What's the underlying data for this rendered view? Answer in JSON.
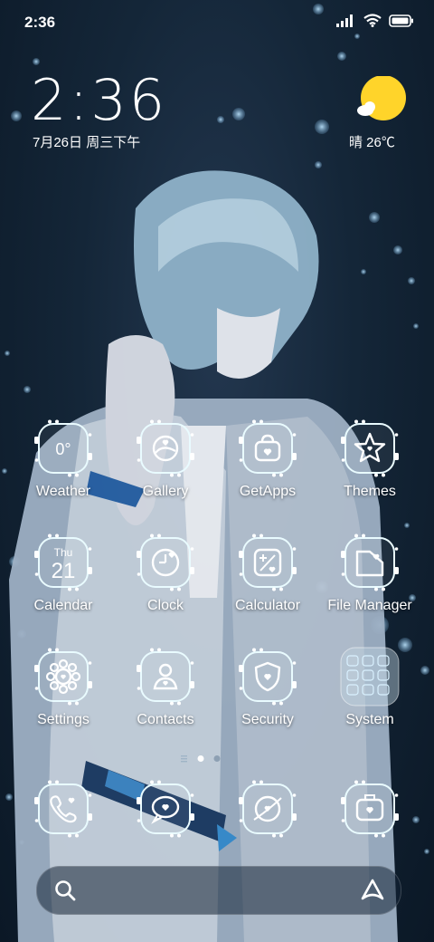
{
  "status": {
    "time": "2:36"
  },
  "lock_clock": {
    "time": "2:36",
    "date": "7月26日 周三下午"
  },
  "weather": {
    "text": "晴 26℃",
    "icon": "sun-cloud-icon",
    "sun_color": "#FFD42A"
  },
  "apps": [
    {
      "label": "Weather",
      "icon": "weather-icon",
      "value": "0°"
    },
    {
      "label": "Gallery",
      "icon": "gallery-icon"
    },
    {
      "label": "GetApps",
      "icon": "getapps-icon"
    },
    {
      "label": "Themes",
      "icon": "themes-icon"
    },
    {
      "label": "Calendar",
      "icon": "calendar-icon",
      "day": "Thu",
      "date": "21"
    },
    {
      "label": "Clock",
      "icon": "clock-icon"
    },
    {
      "label": "Calculator",
      "icon": "calculator-icon"
    },
    {
      "label": "File Manager",
      "icon": "file-manager-icon"
    },
    {
      "label": "Settings",
      "icon": "settings-icon"
    },
    {
      "label": "Contacts",
      "icon": "contacts-icon"
    },
    {
      "label": "Security",
      "icon": "security-icon"
    },
    {
      "label": "System",
      "icon": "system-folder-icon"
    }
  ],
  "dock": [
    {
      "icon": "phone-icon"
    },
    {
      "icon": "messages-icon"
    },
    {
      "icon": "browser-icon"
    },
    {
      "icon": "camera-icon"
    }
  ],
  "page_indicator": {
    "pages": 2,
    "current": 1
  },
  "search": {
    "left_icon": "search-icon",
    "right_icon": "assistant-icon"
  },
  "colors": {
    "accent_glow": "#CFF6FF",
    "background": "#142638"
  }
}
